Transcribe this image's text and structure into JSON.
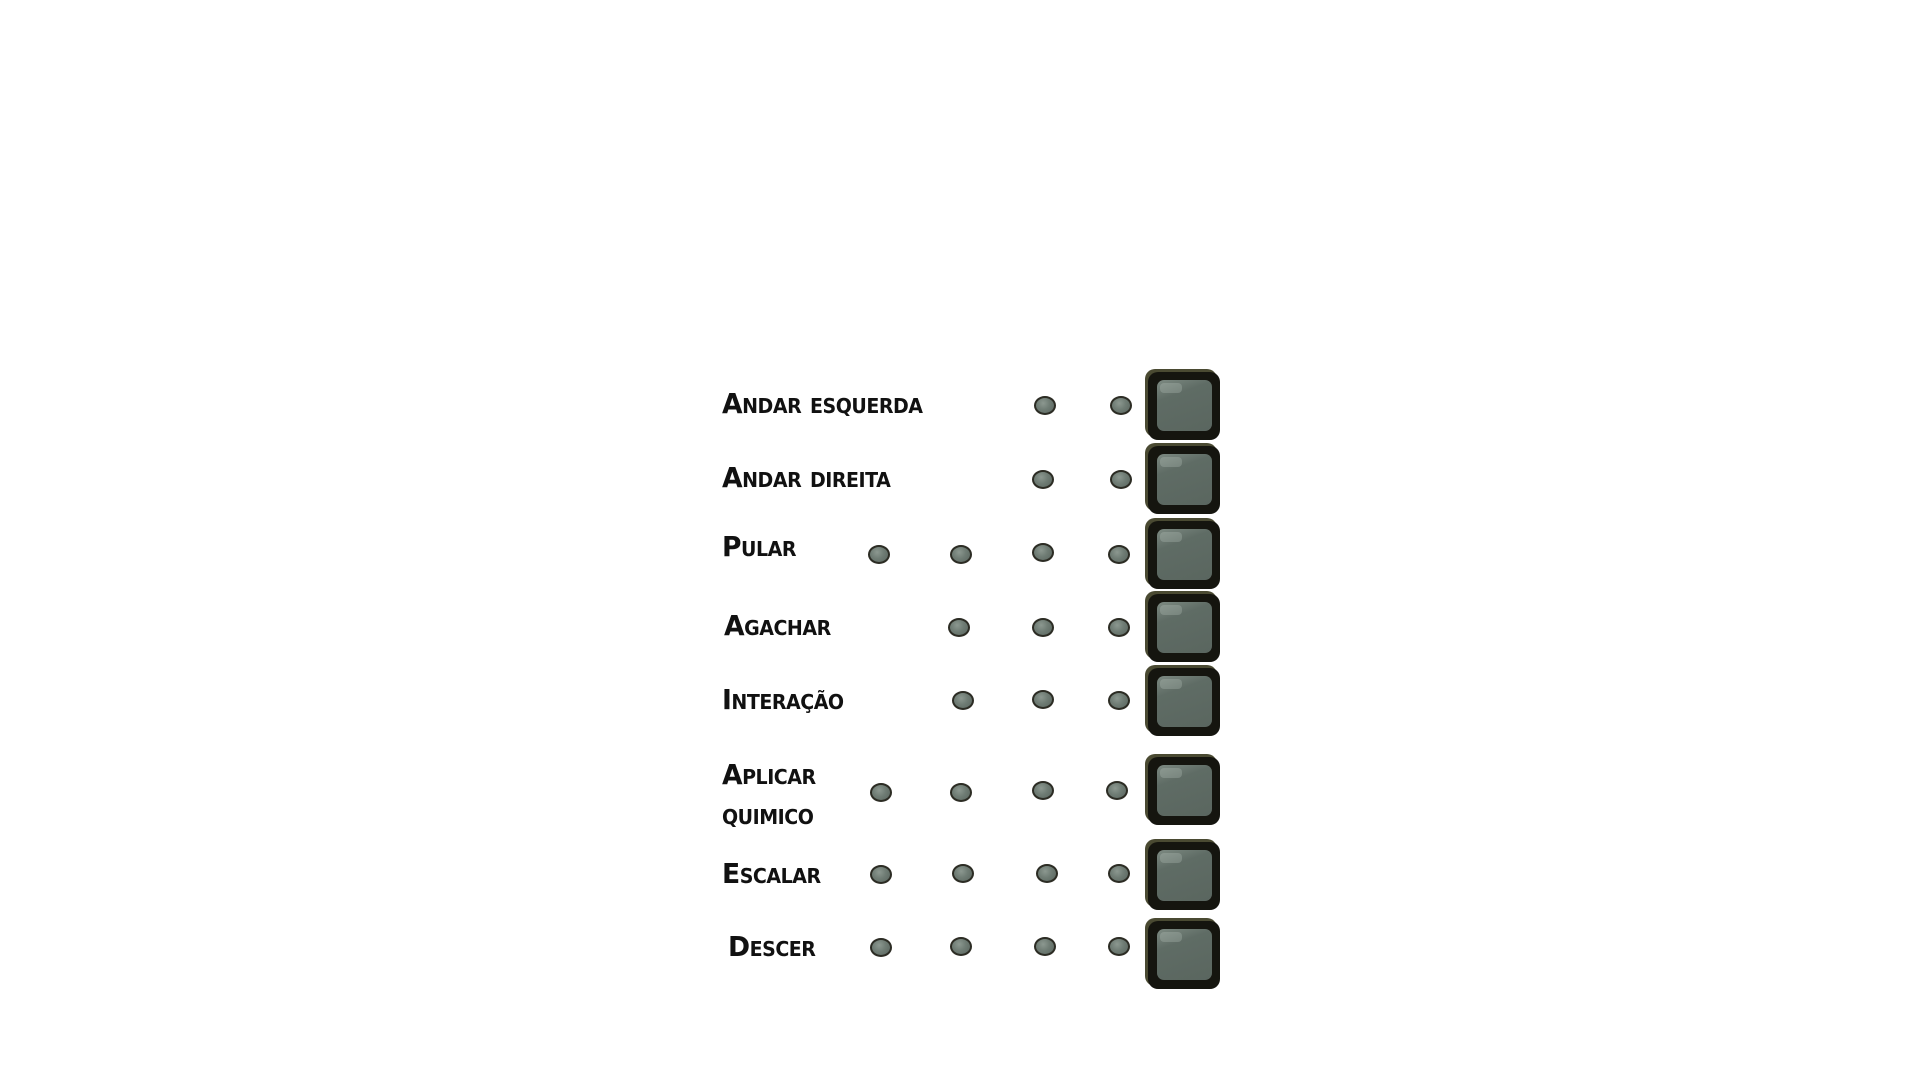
{
  "controls": [
    {
      "label": "Andar esquerda",
      "dots": 2
    },
    {
      "label": "Andar direita",
      "dots": 2
    },
    {
      "label": "Pular",
      "dots": 4
    },
    {
      "label": "Agachar",
      "dots": 3
    },
    {
      "label": "Interação",
      "dots": 3
    },
    {
      "label": "Aplicar",
      "label2": "quimico",
      "dots": 4
    },
    {
      "label": "Escalar",
      "dots": 4
    },
    {
      "label": "Descer",
      "dots": 4
    }
  ],
  "colors": {
    "background": "#ffffff",
    "text": "#111111",
    "key_fill": "#5f6c65",
    "key_border": "#15150f",
    "dot_fill": "#6f7c74"
  }
}
